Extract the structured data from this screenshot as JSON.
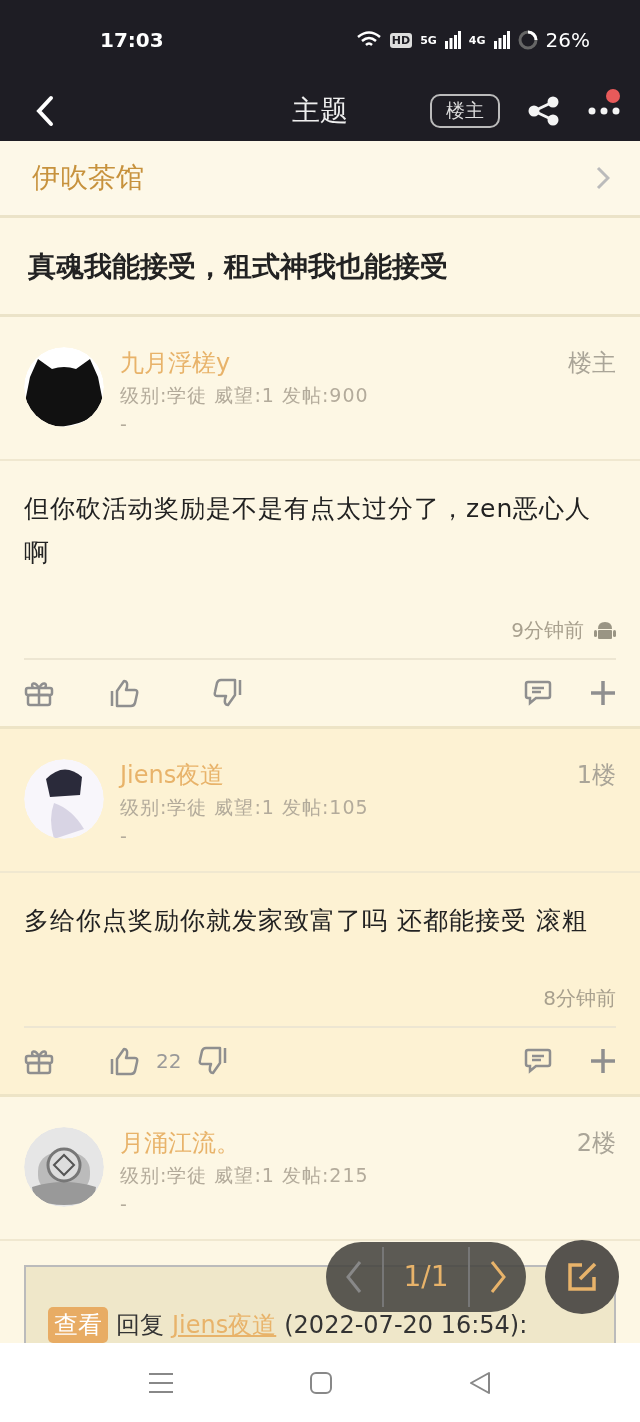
{
  "status_bar": {
    "time": "17:03",
    "hd": "HD",
    "networks": [
      "5G",
      "4G"
    ],
    "battery": "26%"
  },
  "nav": {
    "title": "主题",
    "author_filter": "楼主",
    "has_notification": true
  },
  "forum": {
    "name": "伊吹茶馆"
  },
  "thread": {
    "title": "真魂我能接受，租式神我也能接受"
  },
  "posts": [
    {
      "author": "九月浮槎y",
      "meta": "级别:学徒 威望:1 发帖:900",
      "signature": "-",
      "floor": "楼主",
      "body": "但你砍活动奖励是不是有点太过分了，zen恶心人啊",
      "time": "9分钟前",
      "android": true
    },
    {
      "author": "Jiens夜道",
      "meta": "级别:学徒 威望:1 发帖:105",
      "signature": "-",
      "floor": "1楼",
      "body": "多给你点奖励你就发家致富了吗 还都能接受 滚粗",
      "time": "8分钟前",
      "android": false,
      "likes": "22"
    },
    {
      "author": "月涌江流。",
      "meta": "级别:学徒 威望:1 发帖:215",
      "signature": "-",
      "floor": "2楼",
      "quote": {
        "tag": "查看",
        "verb": "回复",
        "user": "Jiens夜道",
        "date": "(2022-07-20 16:54):"
      }
    }
  ],
  "pager": {
    "page": "1/1"
  }
}
